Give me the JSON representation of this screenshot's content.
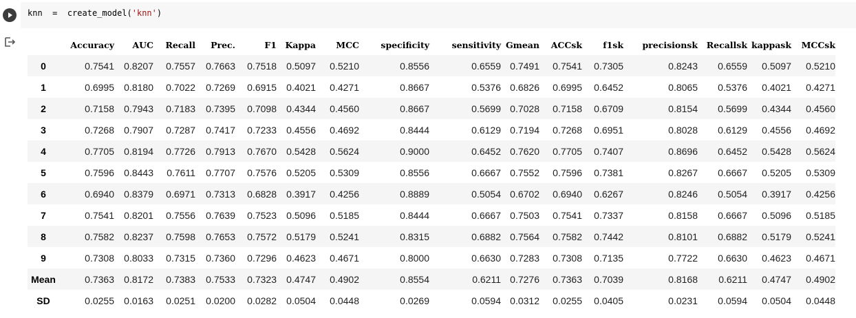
{
  "cell": {
    "code_var": "knn",
    "code_op": "=",
    "code_fn": "create_model(",
    "code_arg": "'knn'",
    "code_close": ")"
  },
  "icons": {
    "run": "play-icon",
    "output": "output-arrow-icon"
  },
  "colors": {
    "code_bg": "#f7f7f7",
    "stripe": "#f5f5f5",
    "run_button": "#3c3c3c"
  },
  "table": {
    "columns": [
      "Accuracy",
      "AUC",
      "Recall",
      "Prec.",
      "F1",
      "Kappa",
      "MCC",
      "specificity",
      "sensitivity",
      "Gmean",
      "ACCsk",
      "f1sk",
      "precisionsk",
      "Recallsk",
      "kappask",
      "MCCsk"
    ],
    "rows": [
      {
        "label": "0",
        "values": [
          "0.7541",
          "0.8207",
          "0.7557",
          "0.7663",
          "0.7518",
          "0.5097",
          "0.5210",
          "0.8556",
          "0.6559",
          "0.7491",
          "0.7541",
          "0.7305",
          "0.8243",
          "0.6559",
          "0.5097",
          "0.5210"
        ]
      },
      {
        "label": "1",
        "values": [
          "0.6995",
          "0.8180",
          "0.7022",
          "0.7269",
          "0.6915",
          "0.4021",
          "0.4271",
          "0.8667",
          "0.5376",
          "0.6826",
          "0.6995",
          "0.6452",
          "0.8065",
          "0.5376",
          "0.4021",
          "0.4271"
        ]
      },
      {
        "label": "2",
        "values": [
          "0.7158",
          "0.7943",
          "0.7183",
          "0.7395",
          "0.7098",
          "0.4344",
          "0.4560",
          "0.8667",
          "0.5699",
          "0.7028",
          "0.7158",
          "0.6709",
          "0.8154",
          "0.5699",
          "0.4344",
          "0.4560"
        ]
      },
      {
        "label": "3",
        "values": [
          "0.7268",
          "0.7907",
          "0.7287",
          "0.7417",
          "0.7233",
          "0.4556",
          "0.4692",
          "0.8444",
          "0.6129",
          "0.7194",
          "0.7268",
          "0.6951",
          "0.8028",
          "0.6129",
          "0.4556",
          "0.4692"
        ]
      },
      {
        "label": "4",
        "values": [
          "0.7705",
          "0.8194",
          "0.7726",
          "0.7913",
          "0.7670",
          "0.5428",
          "0.5624",
          "0.9000",
          "0.6452",
          "0.7620",
          "0.7705",
          "0.7407",
          "0.8696",
          "0.6452",
          "0.5428",
          "0.5624"
        ]
      },
      {
        "label": "5",
        "values": [
          "0.7596",
          "0.8443",
          "0.7611",
          "0.7707",
          "0.7576",
          "0.5205",
          "0.5309",
          "0.8556",
          "0.6667",
          "0.7552",
          "0.7596",
          "0.7381",
          "0.8267",
          "0.6667",
          "0.5205",
          "0.5309"
        ]
      },
      {
        "label": "6",
        "values": [
          "0.6940",
          "0.8379",
          "0.6971",
          "0.7313",
          "0.6828",
          "0.3917",
          "0.4256",
          "0.8889",
          "0.5054",
          "0.6702",
          "0.6940",
          "0.6267",
          "0.8246",
          "0.5054",
          "0.3917",
          "0.4256"
        ]
      },
      {
        "label": "7",
        "values": [
          "0.7541",
          "0.8201",
          "0.7556",
          "0.7639",
          "0.7523",
          "0.5096",
          "0.5185",
          "0.8444",
          "0.6667",
          "0.7503",
          "0.7541",
          "0.7337",
          "0.8158",
          "0.6667",
          "0.5096",
          "0.5185"
        ]
      },
      {
        "label": "8",
        "values": [
          "0.7582",
          "0.8237",
          "0.7598",
          "0.7653",
          "0.7572",
          "0.5179",
          "0.5241",
          "0.8315",
          "0.6882",
          "0.7564",
          "0.7582",
          "0.7442",
          "0.8101",
          "0.6882",
          "0.5179",
          "0.5241"
        ]
      },
      {
        "label": "9",
        "values": [
          "0.7308",
          "0.8033",
          "0.7315",
          "0.7360",
          "0.7296",
          "0.4623",
          "0.4671",
          "0.8000",
          "0.6630",
          "0.7283",
          "0.7308",
          "0.7135",
          "0.7722",
          "0.6630",
          "0.4623",
          "0.4671"
        ]
      },
      {
        "label": "Mean",
        "values": [
          "0.7363",
          "0.8172",
          "0.7383",
          "0.7533",
          "0.7323",
          "0.4747",
          "0.4902",
          "0.8554",
          "0.6211",
          "0.7276",
          "0.7363",
          "0.7039",
          "0.8168",
          "0.6211",
          "0.4747",
          "0.4902"
        ]
      },
      {
        "label": "SD",
        "values": [
          "0.0255",
          "0.0163",
          "0.0251",
          "0.0200",
          "0.0282",
          "0.0504",
          "0.0448",
          "0.0269",
          "0.0594",
          "0.0312",
          "0.0255",
          "0.0405",
          "0.0231",
          "0.0594",
          "0.0504",
          "0.0448"
        ]
      }
    ]
  }
}
